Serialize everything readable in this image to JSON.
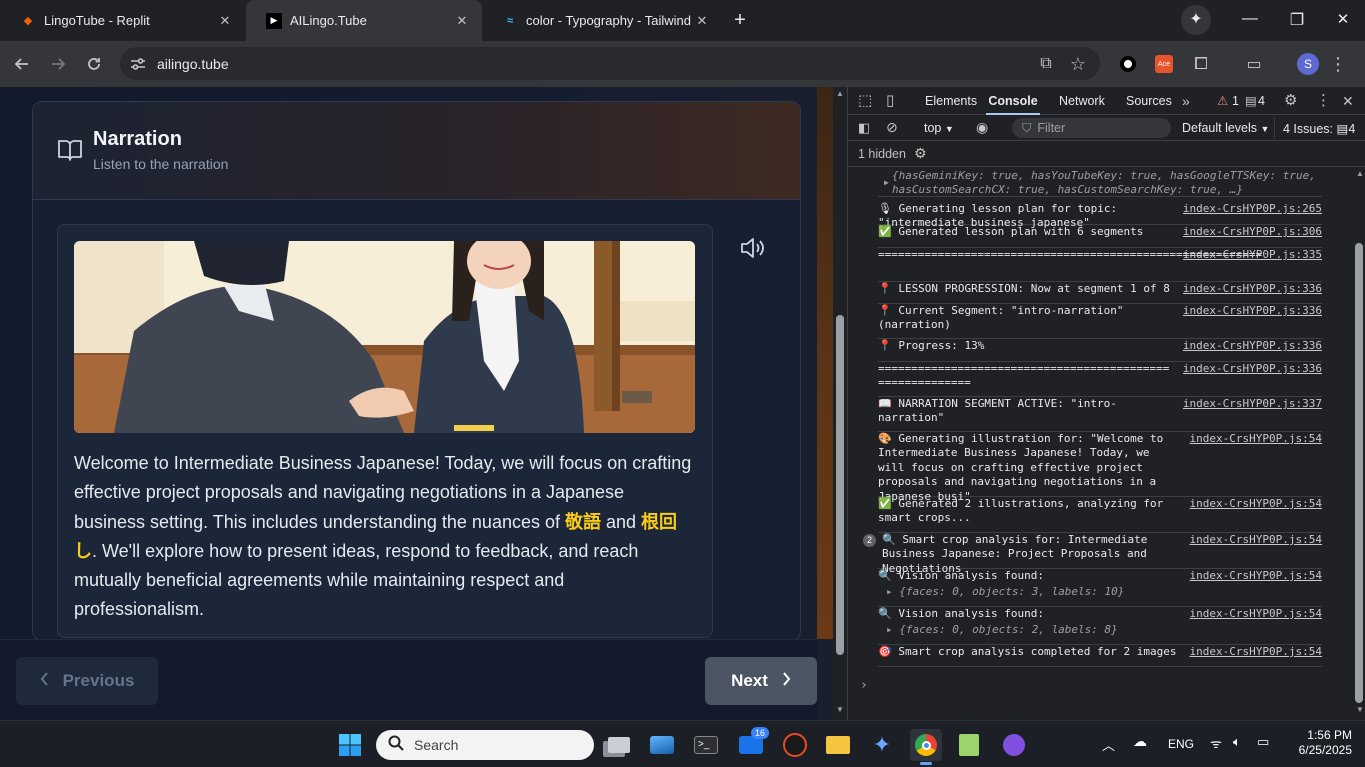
{
  "browser": {
    "tabs": [
      {
        "title": "LingoTube - Replit",
        "active": false
      },
      {
        "title": "AILingo.Tube",
        "active": true
      },
      {
        "title": "color - Typography - Tailwind CSS",
        "active": false
      }
    ],
    "url": "ailingo.tube",
    "profile_initial": "S",
    "ext_badge": "Ace"
  },
  "lesson": {
    "section_title": "Narration",
    "section_subtitle": "Listen to the narration",
    "narration_part1": "Welcome to Intermediate Business Japanese! Today, we will focus on crafting effective project proposals and navigating negotiations in a Japanese business setting. This includes understanding the nuances of ",
    "term1": "敬語",
    "narration_and": " and ",
    "term2": "根回し",
    "narration_part2": ". We'll explore how to present ideas, respond to feedback, and reach mutually beneficial agreements while maintaining respect and professionalism.",
    "prev_label": "Previous",
    "next_label": "Next"
  },
  "devtools": {
    "tabs": [
      "Elements",
      "Console",
      "Network",
      "Sources"
    ],
    "active_tab": "Console",
    "warning_count": "1",
    "message_count": "4",
    "context": "top",
    "filter_placeholder": "Filter",
    "levels": "Default levels",
    "issues": "4 Issues:",
    "issues_count": "4",
    "hidden": "1 hidden",
    "log_top_line1": "{hasGeminiKey: true, hasYouTubeKey: true, hasGoogleTTSKey: true,",
    "log_top_line2": "hasCustomSearchCX: true, hasCustomSearchKey: true, …}",
    "logs": [
      {
        "icon": "🎙",
        "text": "Generating lesson plan for topic: \"intermediate business japanese\"",
        "src": "index-CrsHYP0P.js:265"
      },
      {
        "icon": "✅",
        "text": "Generated lesson plan with 6 segments",
        "src": "index-CrsHYP0P.js:306"
      },
      {
        "icon": "",
        "text": "==========================================================",
        "src": "index-CrsHYP0P.js:335"
      },
      {
        "icon": "📍",
        "text": "LESSON PROGRESSION: Now at segment 1 of 8",
        "src": "index-CrsHYP0P.js:336"
      },
      {
        "icon": "📍",
        "text": "Current Segment: \"intro-narration\" (narration)",
        "src": "index-CrsHYP0P.js:336"
      },
      {
        "icon": "📍",
        "text": "Progress: 13%",
        "src": "index-CrsHYP0P.js:336"
      },
      {
        "icon": "",
        "text": "============================================ ==============",
        "src": "index-CrsHYP0P.js:336"
      },
      {
        "icon": "📖",
        "text": "NARRATION SEGMENT ACTIVE: \"intro-narration\"",
        "src": "index-CrsHYP0P.js:337"
      },
      {
        "icon": "🎨",
        "text": "Generating illustration for: \"Welcome to Intermediate Business Japanese! Today, we will focus on crafting effective project proposals and navigating negotiations in a Japanese busi\"",
        "src": "index-CrsHYP0P.js:54"
      },
      {
        "icon": "✅",
        "text": "Generated 2 illustrations, analyzing for smart crops...",
        "src": "index-CrsHYP0P.js:54"
      },
      {
        "icon": "🔍",
        "text": "Smart crop analysis for: Intermediate Business Japanese: Project Proposals and Negotiations",
        "src": "index-CrsHYP0P.js:54",
        "count": "2"
      },
      {
        "icon": "🔍",
        "text": "Vision analysis found:",
        "src": "index-CrsHYP0P.js:54",
        "obj": "{faces: 0, objects: 3, labels: 10}"
      },
      {
        "icon": "🔍",
        "text": "Vision analysis found:",
        "src": "index-CrsHYP0P.js:54",
        "obj": "{faces: 0, objects: 2, labels: 8}"
      },
      {
        "icon": "🎯",
        "text": "Smart crop analysis completed for 2 images",
        "src": "index-CrsHYP0P.js:54"
      }
    ],
    "prompt": "›"
  },
  "taskbar": {
    "search": "Search",
    "mail_badge": "16",
    "lang": "ENG",
    "time": "1:56 PM",
    "date": "6/25/2025"
  },
  "colors": {
    "accent_yellow": "#facc15",
    "page_bg": "#121b2c",
    "next_button": "#4b5563"
  }
}
